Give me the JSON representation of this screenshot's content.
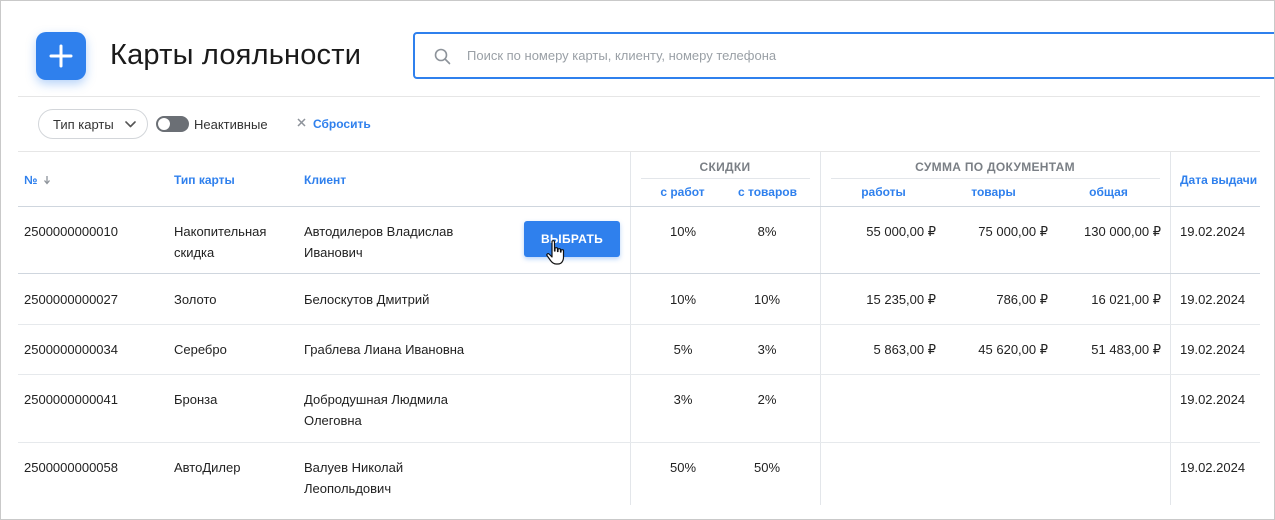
{
  "header": {
    "title": "Карты лояльности",
    "search_placeholder": "Поиск по номеру карты, клиенту, номеру телефона"
  },
  "filters": {
    "card_type_label": "Тип карты",
    "inactive_label": "Неактивные",
    "inactive_enabled": false,
    "reset_label": "Сбросить"
  },
  "table": {
    "columns": {
      "number": "№",
      "card_type": "Тип карты",
      "client": "Клиент",
      "discounts_group": "СКИДКИ",
      "discount_works": "с работ",
      "discount_goods": "с товаров",
      "docs_group": "СУММА ПО ДОКУМЕНТАМ",
      "sum_works": "работы",
      "sum_goods": "товары",
      "sum_total": "общая",
      "issue_date": "Дата выдачи"
    },
    "select_button_label": "ВЫБРАТЬ",
    "rows": [
      {
        "number": "2500000000010",
        "card_type": "Накопительная скидка",
        "client": "Автодилеров Владислав Иванович",
        "discount_works": "10%",
        "discount_goods": "8%",
        "sum_works": "55 000,00 ₽",
        "sum_goods": "75 000,00 ₽",
        "sum_total": "130 000,00 ₽",
        "issue_date": "19.02.2024"
      },
      {
        "number": "2500000000027",
        "card_type": "Золото",
        "client": "Белоскутов Дмитрий",
        "discount_works": "10%",
        "discount_goods": "10%",
        "sum_works": "15 235,00 ₽",
        "sum_goods": "786,00 ₽",
        "sum_total": "16 021,00 ₽",
        "issue_date": "19.02.2024"
      },
      {
        "number": "2500000000034",
        "card_type": "Серебро",
        "client": "Граблева Лиана Ивановна",
        "discount_works": "5%",
        "discount_goods": "3%",
        "sum_works": "5 863,00 ₽",
        "sum_goods": "45 620,00 ₽",
        "sum_total": "51 483,00 ₽",
        "issue_date": "19.02.2024"
      },
      {
        "number": "2500000000041",
        "card_type": "Бронза",
        "client": "Добродушная Людмила Олеговна",
        "discount_works": "3%",
        "discount_goods": "2%",
        "sum_works": "",
        "sum_goods": "",
        "sum_total": "",
        "issue_date": "19.02.2024"
      },
      {
        "number": "2500000000058",
        "card_type": "АвтоДилер",
        "client": "Валуев Николай Леопольдович",
        "discount_works": "50%",
        "discount_goods": "50%",
        "sum_works": "",
        "sum_goods": "",
        "sum_total": "",
        "issue_date": "19.02.2024"
      }
    ]
  },
  "colors": {
    "accent": "#2f80ed",
    "header_group_text": "#7a7f85",
    "toggle_off": "#6b6f75"
  },
  "icons": {
    "add": "plus-icon",
    "search": "search-icon",
    "dropdown": "chevron-down-icon",
    "reset": "close-icon",
    "sort": "arrow-down-icon",
    "cursor": "hand-pointer-icon"
  }
}
